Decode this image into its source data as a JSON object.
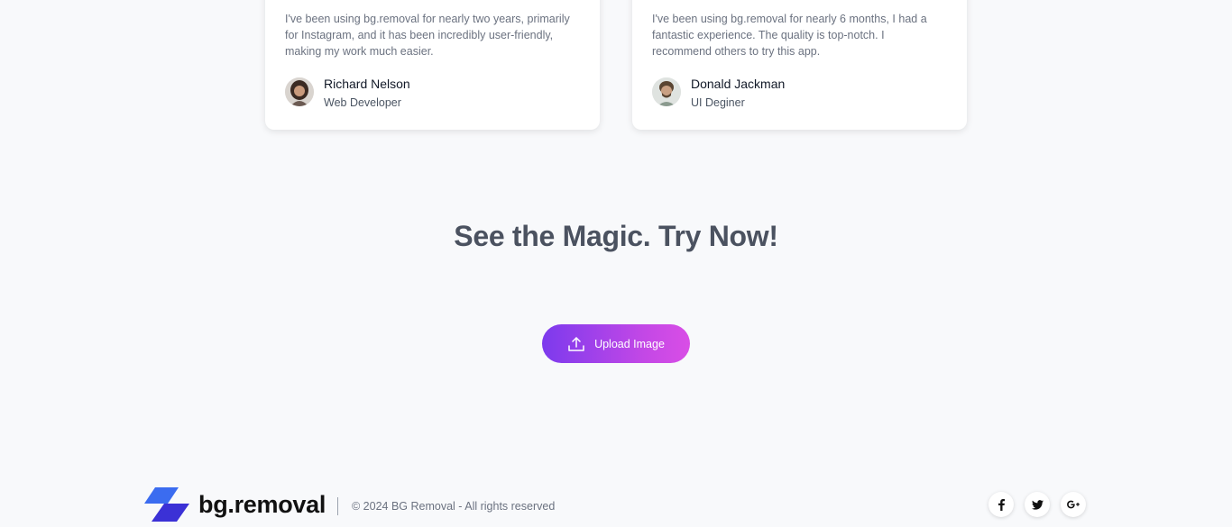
{
  "testimonials": [
    {
      "quote": "I've been using bg.removal for nearly two years, primarily for Instagram, and it has been incredibly user-friendly, making my work much easier.",
      "name": "Richard Nelson",
      "role": "Web Developer"
    },
    {
      "quote": "I've been using bg.removal for nearly 6 months, I had a fantastic experience. The quality is top-notch. I recommend others to try this app.",
      "name": "Donald Jackman",
      "role": "UI Deginer"
    }
  ],
  "cta": {
    "headline": "See the Magic. Try Now!",
    "button_label": "Upload Image",
    "icon": "upload-icon"
  },
  "footer": {
    "logo_text": "bg.removal",
    "copyright": "© 2024 BG Removal - All rights reserved",
    "social": [
      {
        "icon": "facebook-icon",
        "glyph": "f"
      },
      {
        "icon": "twitter-icon",
        "glyph": "t"
      },
      {
        "icon": "google-plus-icon",
        "glyph": "G+"
      }
    ]
  },
  "colors": {
    "accent_start": "#7c3aed",
    "accent_end": "#d94ee6",
    "logo_blue": "#3b4fe0"
  }
}
